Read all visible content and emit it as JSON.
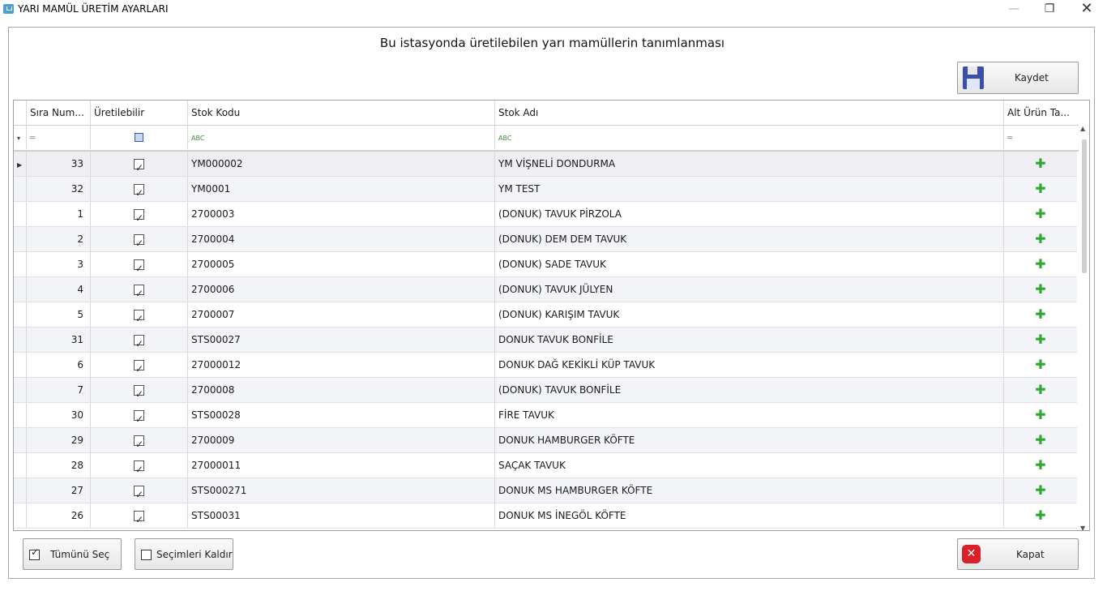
{
  "window": {
    "title": "YARI MAMÜL ÜRETİM AYARLARI"
  },
  "heading": "Bu istasyonda üretilebilen yarı mamüllerin tanımlanması",
  "toolbar": {
    "save_label": "Kaydet"
  },
  "grid": {
    "columns": [
      "Sıra Num...",
      "Üretilebilir",
      "Stok Kodu",
      "Stok Adı",
      "Alt Ürün Ta..."
    ],
    "rows": [
      {
        "sira": "33",
        "uretilebilir": true,
        "kod": "YM000002",
        "adi": "YM VİŞNELİ DONDURMA"
      },
      {
        "sira": "32",
        "uretilebilir": true,
        "kod": "YM0001",
        "adi": "YM TEST"
      },
      {
        "sira": "1",
        "uretilebilir": true,
        "kod": "2700003",
        "adi": "(DONUK) TAVUK PİRZOLA"
      },
      {
        "sira": "2",
        "uretilebilir": true,
        "kod": "2700004",
        "adi": "(DONUK) DEM DEM TAVUK"
      },
      {
        "sira": "3",
        "uretilebilir": true,
        "kod": "2700005",
        "adi": "(DONUK) SADE TAVUK"
      },
      {
        "sira": "4",
        "uretilebilir": true,
        "kod": "2700006",
        "adi": "(DONUK) TAVUK JÜLYEN"
      },
      {
        "sira": "5",
        "uretilebilir": true,
        "kod": "2700007",
        "adi": "(DONUK) KARIŞIM TAVUK"
      },
      {
        "sira": "31",
        "uretilebilir": true,
        "kod": "STS00027",
        "adi": "DONUK TAVUK BONFİLE"
      },
      {
        "sira": "6",
        "uretilebilir": true,
        "kod": "27000012",
        "adi": "DONUK DAĞ KEKİKLİ KÜP TAVUK"
      },
      {
        "sira": "7",
        "uretilebilir": true,
        "kod": "2700008",
        "adi": "(DONUK) TAVUK BONFİLE"
      },
      {
        "sira": "30",
        "uretilebilir": true,
        "kod": "STS00028",
        "adi": "FİRE TAVUK"
      },
      {
        "sira": "29",
        "uretilebilir": true,
        "kod": "2700009",
        "adi": "DONUK HAMBURGER KÖFTE"
      },
      {
        "sira": "28",
        "uretilebilir": true,
        "kod": "27000011",
        "adi": "SAÇAK TAVUK"
      },
      {
        "sira": "27",
        "uretilebilir": true,
        "kod": "STS000271",
        "adi": "DONUK MS HAMBURGER KÖFTE"
      },
      {
        "sira": "26",
        "uretilebilir": true,
        "kod": "STS00031",
        "adi": "DONUK MS İNEGÖL KÖFTE"
      }
    ]
  },
  "footer": {
    "select_all_label": "Tümünü Seç",
    "clear_label": "Seçimleri Kaldır",
    "close_label": "Kapat"
  },
  "colors": {
    "plus": "#2eaa2e",
    "close_icon": "#d9202b",
    "save_icon": "#3c4ea8"
  }
}
